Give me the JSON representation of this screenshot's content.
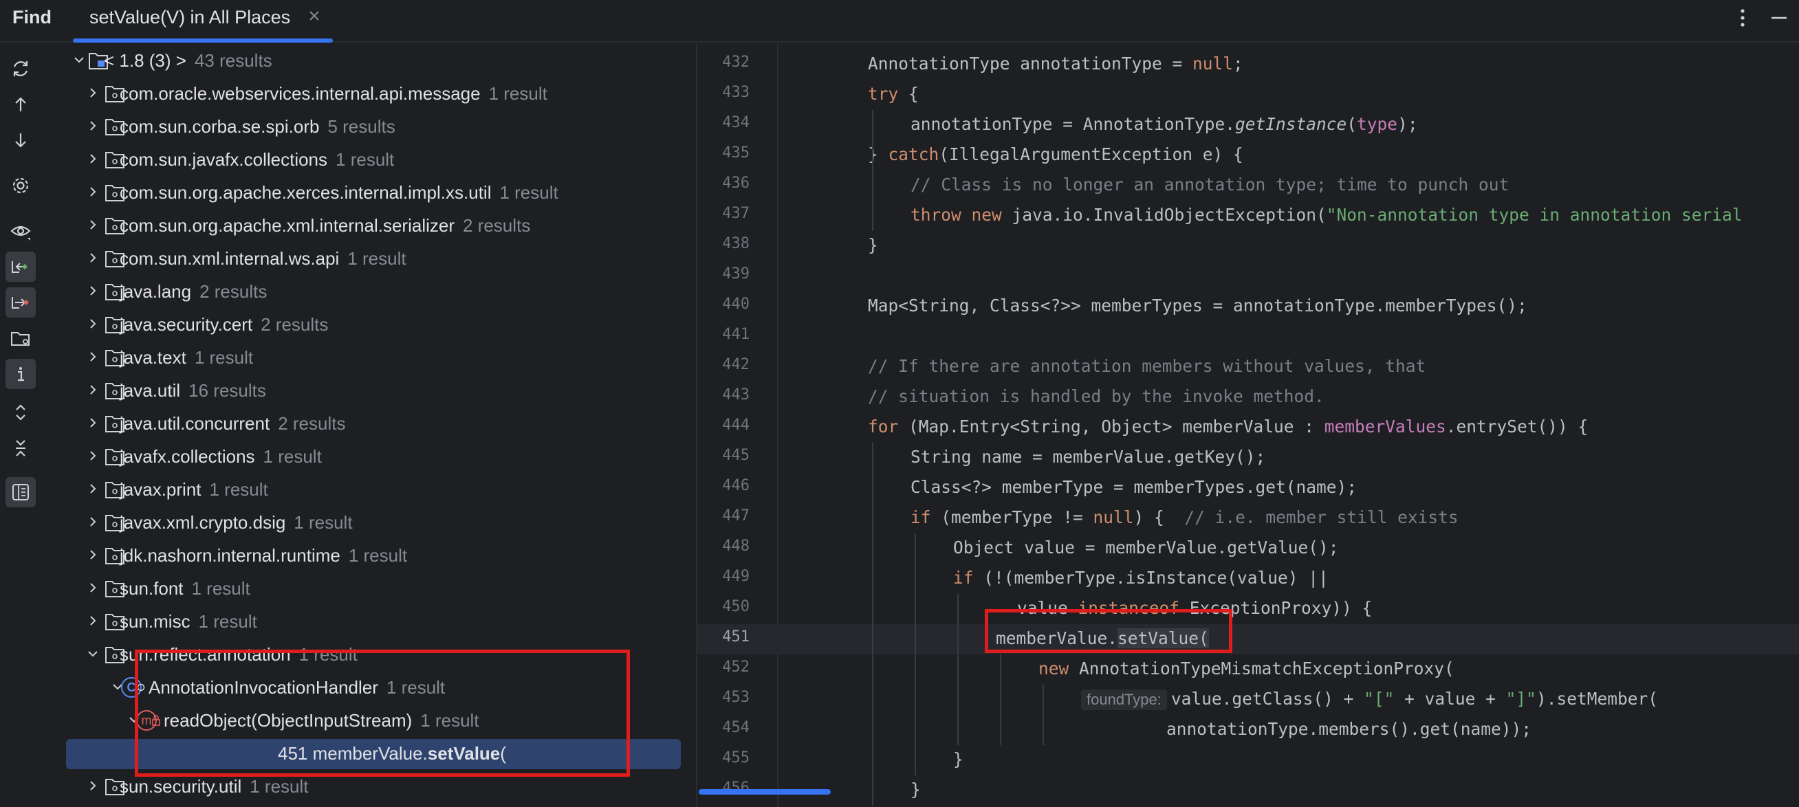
{
  "topbar": {
    "find_label": "Find",
    "tab_title": "setValue(V) in All Places"
  },
  "icons": {
    "toolbar": [
      "refresh-icon",
      "arrow-up-icon",
      "arrow-down-icon",
      "settings-icon",
      "preview-icon",
      "read-access-icon",
      "write-access-icon",
      "group-by-directory-icon",
      "info-icon",
      "expand-all-icon",
      "collapse-all-icon",
      "show-preview-panel-icon"
    ]
  },
  "tree": {
    "root": {
      "label": "< 1.8 (3) >",
      "count": "43 results"
    },
    "packages": [
      {
        "label": "com.oracle.webservices.internal.api.message",
        "count": "1 result"
      },
      {
        "label": "com.sun.corba.se.spi.orb",
        "count": "5 results"
      },
      {
        "label": "com.sun.javafx.collections",
        "count": "1 result"
      },
      {
        "label": "com.sun.org.apache.xerces.internal.impl.xs.util",
        "count": "1 result"
      },
      {
        "label": "com.sun.org.apache.xml.internal.serializer",
        "count": "2 results"
      },
      {
        "label": "com.sun.xml.internal.ws.api",
        "count": "1 result"
      },
      {
        "label": "java.lang",
        "count": "2 results"
      },
      {
        "label": "java.security.cert",
        "count": "2 results"
      },
      {
        "label": "java.text",
        "count": "1 result"
      },
      {
        "label": "java.util",
        "count": "16 results"
      },
      {
        "label": "java.util.concurrent",
        "count": "2 results"
      },
      {
        "label": "javafx.collections",
        "count": "1 result"
      },
      {
        "label": "javax.print",
        "count": "1 result"
      },
      {
        "label": "javax.xml.crypto.dsig",
        "count": "1 result"
      },
      {
        "label": "jdk.nashorn.internal.runtime",
        "count": "1 result"
      },
      {
        "label": "sun.font",
        "count": "1 result"
      },
      {
        "label": "sun.misc",
        "count": "1 result"
      }
    ],
    "expanded_package": {
      "label": "sun.reflect.annotation",
      "count": "1 result"
    },
    "class_node": {
      "label": "AnnotationInvocationHandler",
      "count": "1 result",
      "icon_letter": "C"
    },
    "method_node": {
      "label": "readObject(ObjectInputStream)",
      "count": "1 result",
      "icon_letter": "m"
    },
    "selected_usage": {
      "prefix": "451 memberValue.",
      "match": "setValue",
      "suffix": "("
    },
    "after_package": {
      "label": "sun.security.util",
      "count": "1 result"
    }
  },
  "editor": {
    "lines": [
      {
        "n": "432",
        "indent": 2,
        "parts": [
          [
            "t",
            "AnnotationType annotationType = "
          ],
          [
            "kw",
            "null"
          ],
          [
            "t",
            ";"
          ]
        ]
      },
      {
        "n": "433",
        "indent": 2,
        "parts": [
          [
            "kw",
            "try"
          ],
          [
            "t",
            " {"
          ]
        ]
      },
      {
        "n": "434",
        "indent": 3,
        "parts": [
          [
            "t",
            "annotationType = AnnotationType."
          ],
          [
            "it",
            "getInstance"
          ],
          [
            "t",
            "("
          ],
          [
            "fld",
            "type"
          ],
          [
            "t",
            ");"
          ]
        ]
      },
      {
        "n": "435",
        "indent": 2,
        "parts": [
          [
            "t",
            "} "
          ],
          [
            "kw",
            "catch"
          ],
          [
            "t",
            "(IllegalArgumentException e) {"
          ]
        ]
      },
      {
        "n": "436",
        "indent": 3,
        "parts": [
          [
            "cm",
            "// Class is no longer an annotation type; time to punch out"
          ]
        ]
      },
      {
        "n": "437",
        "indent": 3,
        "parts": [
          [
            "kw",
            "throw new "
          ],
          [
            "t",
            "java.io.InvalidObjectException("
          ],
          [
            "str",
            "\"Non-annotation type in annotation serial"
          ]
        ]
      },
      {
        "n": "438",
        "indent": 2,
        "parts": [
          [
            "t",
            "}"
          ]
        ]
      },
      {
        "n": "439",
        "indent": 0,
        "parts": []
      },
      {
        "n": "440",
        "indent": 2,
        "parts": [
          [
            "t",
            "Map<String, Class<?>> memberTypes = annotationType.memberTypes();"
          ]
        ]
      },
      {
        "n": "441",
        "indent": 0,
        "parts": []
      },
      {
        "n": "442",
        "indent": 2,
        "parts": [
          [
            "cm",
            "// If there are annotation members without values, that"
          ]
        ]
      },
      {
        "n": "443",
        "indent": 2,
        "parts": [
          [
            "cm",
            "// situation is handled by the invoke method."
          ]
        ]
      },
      {
        "n": "444",
        "indent": 2,
        "parts": [
          [
            "kw",
            "for "
          ],
          [
            "t",
            "(Map.Entry<String, Object> memberValue : "
          ],
          [
            "fld",
            "memberValues"
          ],
          [
            "t",
            ".entrySet()) {"
          ]
        ]
      },
      {
        "n": "445",
        "indent": 3,
        "parts": [
          [
            "t",
            "String name = memberValue.getKey();"
          ]
        ]
      },
      {
        "n": "446",
        "indent": 3,
        "parts": [
          [
            "t",
            "Class<?> memberType = memberTypes.get(name);"
          ]
        ]
      },
      {
        "n": "447",
        "indent": 3,
        "parts": [
          [
            "kw",
            "if "
          ],
          [
            "t",
            "(memberType != "
          ],
          [
            "kw",
            "null"
          ],
          [
            "t",
            ") {  "
          ],
          [
            "cm",
            "// i.e. member still exists"
          ]
        ]
      },
      {
        "n": "448",
        "indent": 4,
        "parts": [
          [
            "t",
            "Object value = memberValue.getValue();"
          ]
        ]
      },
      {
        "n": "449",
        "indent": 4,
        "parts": [
          [
            "kw",
            "if "
          ],
          [
            "t",
            "(!(memberType.isInstance(value) ||"
          ]
        ]
      },
      {
        "n": "450",
        "indent": 5.5,
        "parts": [
          [
            "t",
            "value "
          ],
          [
            "kw",
            "instanceof "
          ],
          [
            "t",
            "ExceptionProxy)) {"
          ]
        ]
      },
      {
        "n": "451",
        "indent": 5,
        "current": true,
        "parts": [
          [
            "t",
            "memberValue."
          ],
          [
            "hl",
            "setValue("
          ]
        ]
      },
      {
        "n": "452",
        "indent": 6,
        "parts": [
          [
            "kw",
            "new "
          ],
          [
            "t",
            "AnnotationTypeMismatchExceptionProxy("
          ]
        ]
      },
      {
        "n": "453",
        "indent": 7,
        "parts": [
          [
            "hint",
            "foundType:"
          ],
          [
            "t",
            "value.getClass() + "
          ],
          [
            "str",
            "\"[\""
          ],
          [
            "t",
            " + value + "
          ],
          [
            "str",
            "\"]\""
          ],
          [
            "t",
            ").setMember("
          ]
        ]
      },
      {
        "n": "454",
        "indent": 9,
        "parts": [
          [
            "t",
            "annotationType.members().get(name));"
          ]
        ]
      },
      {
        "n": "455",
        "indent": 4,
        "parts": [
          [
            "t",
            "}"
          ]
        ]
      },
      {
        "n": "456",
        "indent": 3,
        "parts": [
          [
            "t",
            "}"
          ]
        ]
      }
    ]
  }
}
